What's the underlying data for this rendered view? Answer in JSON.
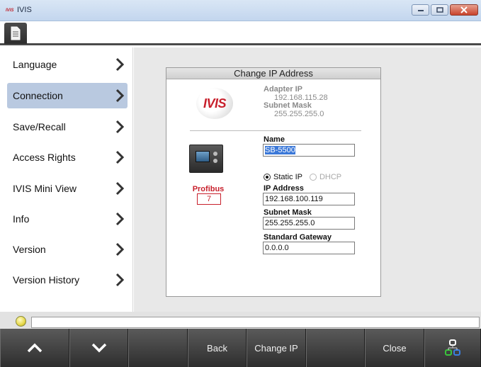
{
  "window": {
    "logo_text": "IVIS",
    "title": "IVIS"
  },
  "sidebar": {
    "items": [
      {
        "label": "Language",
        "active": false
      },
      {
        "label": "Connection",
        "active": true
      },
      {
        "label": "Save/Recall",
        "active": false
      },
      {
        "label": "Access Rights",
        "active": false
      },
      {
        "label": "IVIS Mini View",
        "active": false
      },
      {
        "label": "Info",
        "active": false
      },
      {
        "label": "Version",
        "active": false
      },
      {
        "label": "Version History",
        "active": false
      }
    ]
  },
  "dialog": {
    "title": "Change IP Address",
    "logo_text": "IVIS",
    "adapter_ip_label": "Adapter IP",
    "adapter_ip_value": "192.168.115.28",
    "adapter_mask_label": "Subnet Mask",
    "adapter_mask_value": "255.255.255.0",
    "name_label": "Name",
    "name_value": "SB-5500",
    "static_ip_label": "Static IP",
    "dhcp_label": "DHCP",
    "mode_selected": "Static IP",
    "ip_label": "IP Address",
    "ip_value": "192.168.100.119",
    "subnet_label": "Subnet Mask",
    "subnet_value": "255.255.255.0",
    "gateway_label": "Standard Gateway",
    "gateway_value": "0.0.0.0",
    "profibus_label": "Profibus",
    "profibus_value": "7"
  },
  "bottom_bar": {
    "back_label": "Back",
    "change_ip_label": "Change IP",
    "close_label": "Close"
  },
  "colors": {
    "accent_red": "#c8202c",
    "active_menu": "#b9c9e0",
    "bar_dark": "#3d3d3d"
  }
}
